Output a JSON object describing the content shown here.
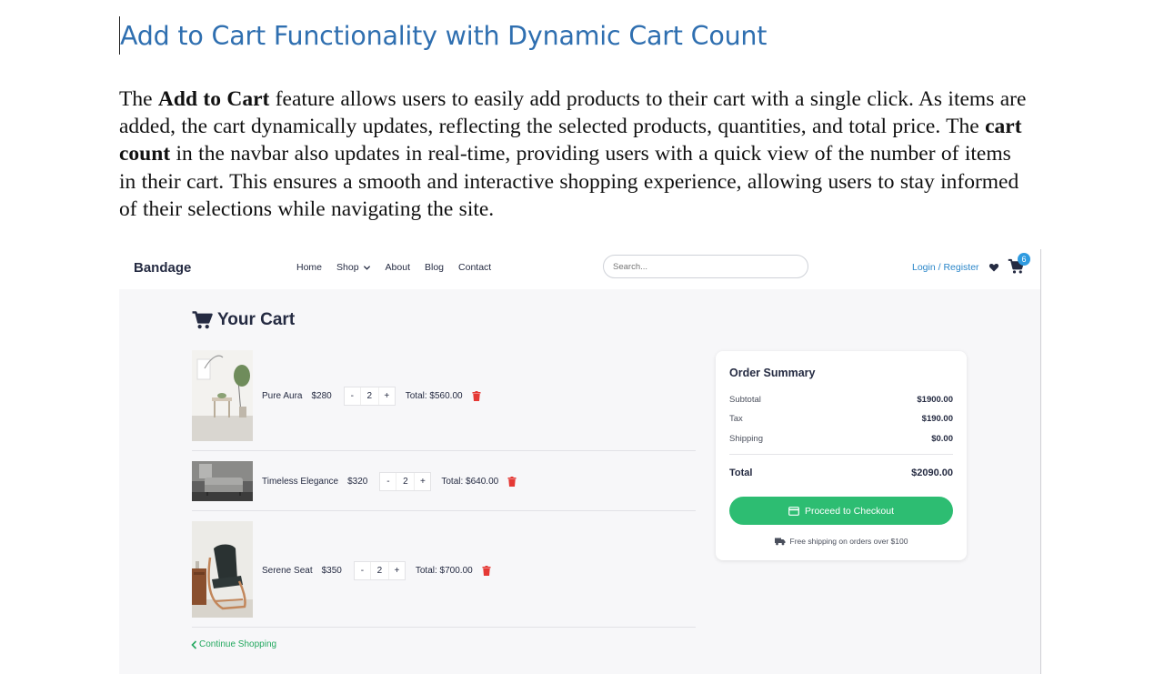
{
  "document": {
    "title": "Add to Cart Functionality with Dynamic Cart Count",
    "para": {
      "t1": "The ",
      "b1": "Add to Cart",
      "t2": " feature allows users to easily add products to their cart with a single click. As items are added, the cart dynamically updates, reflecting the selected products, quantities, and total price. The ",
      "b2": "cart count",
      "t3": " in the navbar also updates in real-time, providing users with a quick view of the number of items in their cart. This ensures a smooth and interactive shopping experience, allowing users to stay informed of their selections while navigating the site."
    }
  },
  "app": {
    "brand": "Bandage",
    "nav": [
      "Home",
      "Shop",
      "About",
      "Blog",
      "Contact"
    ],
    "search_placeholder": "Search...",
    "login": "Login / Register",
    "cart_count": "6",
    "heading": "Your Cart",
    "items": [
      {
        "name": "Pure Aura",
        "price": "$280",
        "qty": "2",
        "total": "Total: $560.00",
        "image": "white-room-with-plant"
      },
      {
        "name": "Timeless Elegance",
        "price": "$320",
        "qty": "2",
        "total": "Total: $640.00",
        "image": "grey-sofa"
      },
      {
        "name": "Serene Seat",
        "price": "$350",
        "qty": "2",
        "total": "Total: $700.00",
        "image": "bentwood-armchair"
      }
    ],
    "qty_minus": "-",
    "qty_plus": "+",
    "continue": "Continue Shopping",
    "summary": {
      "title": "Order Summary",
      "subtotal_label": "Subtotal",
      "subtotal": "$1900.00",
      "tax_label": "Tax",
      "tax": "$190.00",
      "shipping_label": "Shipping",
      "shipping": "$0.00",
      "total_label": "Total",
      "total": "$2090.00",
      "checkout": "Proceed to Checkout",
      "note": "Free shipping on orders over $100"
    },
    "colors": {
      "accent": "#2dbd72",
      "link": "#2a86c9",
      "badge": "#2f9be0",
      "delete": "#e53935"
    }
  }
}
